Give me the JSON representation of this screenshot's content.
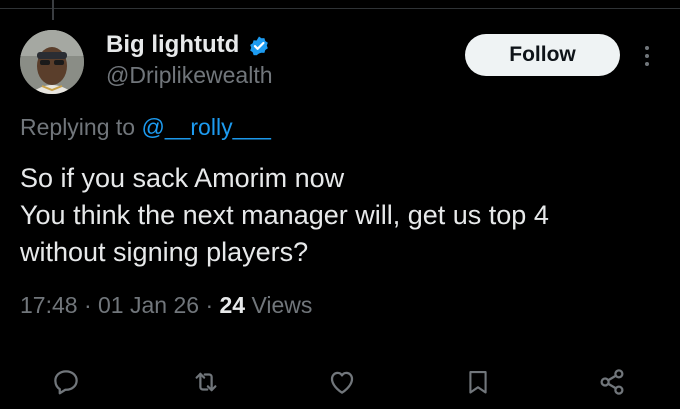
{
  "post": {
    "author": {
      "display_name": "Big lightutd",
      "handle": "@Driplikewealth",
      "verified": true,
      "verified_color": "#1d9bf0"
    },
    "follow_label": "Follow",
    "reply_context": {
      "prefix": "Replying to",
      "handle": "@__rolly___"
    },
    "text_lines": [
      "So if you sack Amorim now",
      "You think the next manager will, get us top 4",
      "without signing players?"
    ],
    "meta": {
      "time": "17:48",
      "separator": "·",
      "date": "01 Jan 26",
      "views_count": "24",
      "views_label": "Views"
    },
    "actions": {
      "reply_icon": "reply-icon",
      "repost_icon": "repost-icon",
      "like_icon": "heart-icon",
      "bookmark_icon": "bookmark-icon",
      "share_icon": "share-icon"
    }
  },
  "colors": {
    "background": "#000000",
    "text_primary": "#e7e9ea",
    "text_secondary": "#71767b",
    "accent": "#1d9bf0",
    "follow_bg": "#eff3f4"
  }
}
